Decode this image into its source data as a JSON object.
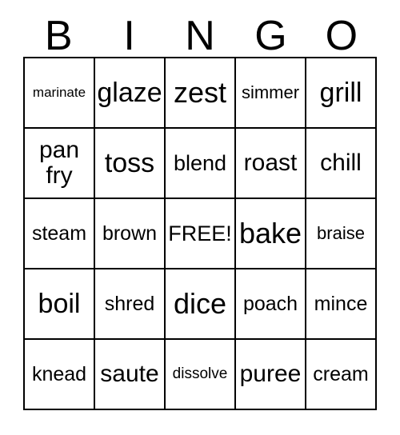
{
  "card": {
    "header_letters": [
      "B",
      "I",
      "N",
      "G",
      "O"
    ],
    "free_space_label": "FREE!",
    "colors": {
      "background": "#ffffff",
      "text": "#000000",
      "border": "#000000"
    },
    "rows": [
      [
        {
          "text": "marinate",
          "size": "fs-xs"
        },
        {
          "text": "glaze",
          "size": "fs-xxl"
        },
        {
          "text": "zest",
          "size": "fs-max"
        },
        {
          "text": "simmer",
          "size": "fs-m"
        },
        {
          "text": "grill",
          "size": "fs-xxl"
        }
      ],
      [
        {
          "text": "pan\nfry",
          "size": "fs-xl"
        },
        {
          "text": "toss",
          "size": "fs-xxl"
        },
        {
          "text": "blend",
          "size": "fs-l"
        },
        {
          "text": "roast",
          "size": "fs-xl"
        },
        {
          "text": "chill",
          "size": "fs-xl"
        }
      ],
      [
        {
          "text": "steam",
          "size": "fs-ml"
        },
        {
          "text": "brown",
          "size": "fs-ml"
        },
        {
          "text": "FREE!",
          "size": "fs-l"
        },
        {
          "text": "bake",
          "size": "fs-max"
        },
        {
          "text": "braise",
          "size": "fs-m"
        }
      ],
      [
        {
          "text": "boil",
          "size": "fs-xxl"
        },
        {
          "text": "shred",
          "size": "fs-ml"
        },
        {
          "text": "dice",
          "size": "fs-max"
        },
        {
          "text": "poach",
          "size": "fs-ml"
        },
        {
          "text": "mince",
          "size": "fs-ml"
        }
      ],
      [
        {
          "text": "knead",
          "size": "fs-ml"
        },
        {
          "text": "saute",
          "size": "fs-xl"
        },
        {
          "text": "dissolve",
          "size": "fs-s"
        },
        {
          "text": "puree",
          "size": "fs-xl"
        },
        {
          "text": "cream",
          "size": "fs-ml"
        }
      ]
    ]
  }
}
